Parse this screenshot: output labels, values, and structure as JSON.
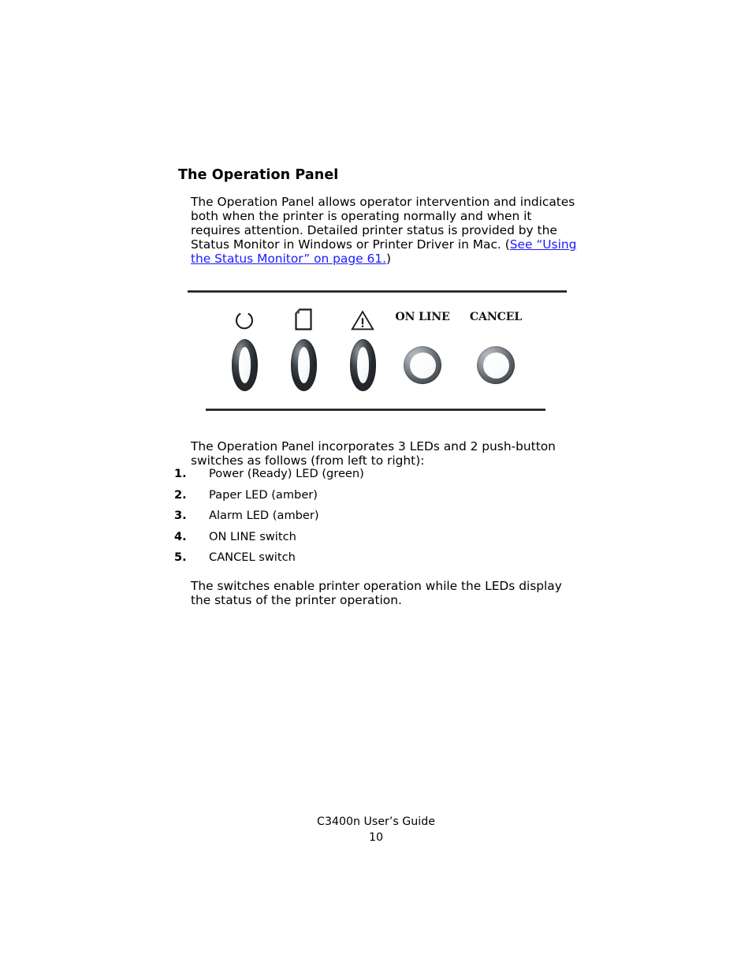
{
  "document": {
    "heading": "The Operation Panel",
    "intro_paragraph": {
      "before_link": "The Operation Panel allows operator intervention and indicates both when the printer is operating normally and when it requires attention. Detailed printer status is provided by the Status Monitor in Windows or Printer Driver in Mac. (",
      "link_text": "See “Using the Status Monitor” on page 61.",
      "after_link": ")"
    },
    "body_paragraph": "The Operation Panel incorporates 3 LEDs and 2 push-button switches as follows (from left to right):",
    "closing_paragraph": "The switches enable printer operation while the LEDs display the status of the printer operation."
  },
  "panel_figure": {
    "items": [
      {
        "icon": "power-ready-led-icon",
        "label": "",
        "control": "led"
      },
      {
        "icon": "paper-led-icon",
        "label": "",
        "control": "led"
      },
      {
        "icon": "alarm-led-icon",
        "label": "",
        "control": "led"
      },
      {
        "icon": "",
        "label": "ON LINE",
        "control": "button"
      },
      {
        "icon": "",
        "label": "CANCEL",
        "control": "button"
      }
    ]
  },
  "numbered_list": [
    {
      "num": "1.",
      "text": "Power (Ready) LED (green)"
    },
    {
      "num": "2.",
      "text": "Paper LED (amber)"
    },
    {
      "num": "3.",
      "text": "Alarm LED (amber)"
    },
    {
      "num": "4.",
      "text": "ON LINE switch"
    },
    {
      "num": "5.",
      "text": "CANCEL switch"
    }
  ],
  "footer": {
    "title": "C3400n User’s Guide",
    "page_number": "10"
  },
  "colors": {
    "link": "#1a1aff",
    "text": "#000000",
    "rule": "#1b1b1b"
  }
}
